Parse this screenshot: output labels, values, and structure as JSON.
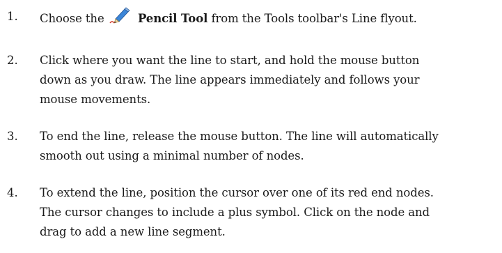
{
  "steps": [
    {
      "number": "1.",
      "prefix": "Choose the",
      "icon": "pencil-tool-icon",
      "bold": "Pencil Tool",
      "suffix": "from the Tools toolbar's Line flyout."
    },
    {
      "number": "2.",
      "lines": [
        "Click where you want the line to start, and hold the mouse button",
        "down as you draw. The line appears immediately and follows your",
        "mouse movements."
      ]
    },
    {
      "number": "3.",
      "lines": [
        "To end the line, release the mouse button. The line will automatically",
        "smooth out using a minimal number of nodes."
      ]
    },
    {
      "number": "4.",
      "lines": [
        "To extend the line, position the cursor over one of its red end nodes.",
        "The cursor changes to include a plus symbol. Click on the node and",
        "drag to add a new line segment."
      ]
    }
  ]
}
